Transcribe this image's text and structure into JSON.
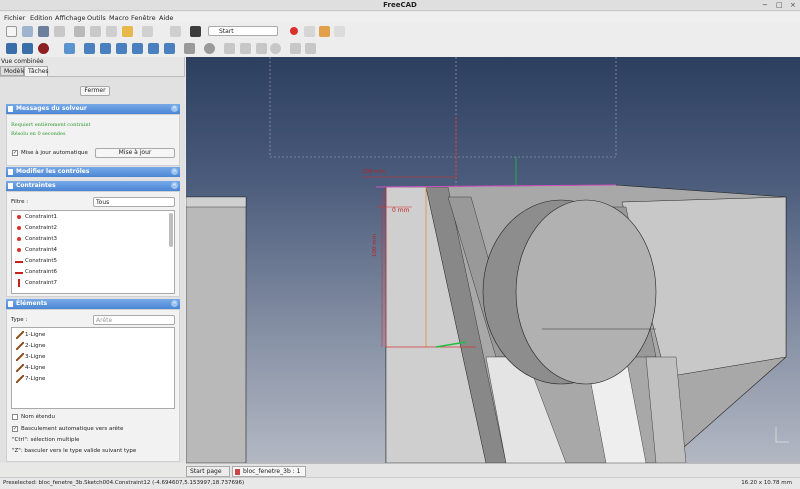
{
  "window": {
    "title": "FreeCAD",
    "controls": [
      "−",
      "□",
      "×"
    ]
  },
  "menu": [
    "Fichier",
    "Edition",
    "Affichage",
    "Outils",
    "Macro",
    "Fenêtre",
    "Aide"
  ],
  "toolbar": {
    "macro_combo": "Start"
  },
  "combo_view": {
    "title": "Vue combinée",
    "tabs": [
      "Modèle",
      "Tâches"
    ],
    "close_button": "Fermer",
    "solver": {
      "header": "Messages du solveur",
      "line1": "Requiert entièrement contraint",
      "line2": "Résolu en 0 secondes",
      "auto_update": "Mise à jour automatique",
      "update_button": "Mise à jour"
    },
    "edit_controls": {
      "header": "Modifier les contrôles"
    },
    "constraints": {
      "header": "Contraintes",
      "filter_label": "Filtre :",
      "filter_value": "Tous",
      "items": [
        "Constraint1",
        "Constraint2",
        "Constraint3",
        "Constraint4",
        "Constraint5",
        "Constraint6",
        "Constraint7"
      ]
    },
    "elements": {
      "header": "Éléments",
      "type_label": "Type :",
      "type_value": "Arête",
      "items": [
        "1-Ligne",
        "2-Ligne",
        "3-Ligne",
        "4-Ligne",
        "7-Ligne"
      ],
      "extended_names": "Nom étendu",
      "auto_switch": "Basculement automatique vers arête",
      "hint1": "\"Ctrl\": sélection multiple",
      "hint2": "\"Z\": basculer vers le type valide suivant type"
    }
  },
  "viewport": {
    "dim_horizontal": "100 mm",
    "dim_zero": "0 mm",
    "dim_vertical": "100 mm"
  },
  "doc_tabs": [
    "Start page",
    "bloc_fenetre_3b : 1"
  ],
  "status": {
    "message": "Preselected: bloc_fenetre_3b.Sketch004.Constraint12 (-4.694607,5.153997,18.737696)",
    "dimensions": "16.20 x 10.78 mm"
  },
  "colors": {
    "section_header": "#4b86d6",
    "constraint_red": "#d8322b",
    "solver_green": "#2c9a2c"
  }
}
